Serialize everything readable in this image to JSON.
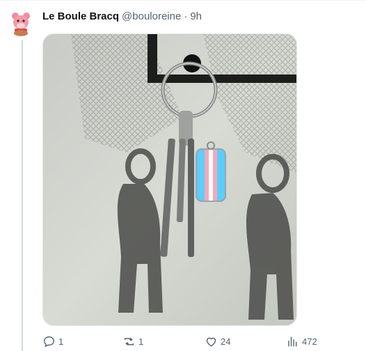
{
  "tweet": {
    "author": {
      "display_name": "Le Boule Bracq",
      "handle": "@bouloreine",
      "avatar_icon": "bear-avatar-icon"
    },
    "separator": "·",
    "timestamp": "9h",
    "media": {
      "kind": "photo",
      "flag_colors": [
        "#5bcefa",
        "#f5a9b8",
        "#ffffff",
        "#f5a9b8",
        "#5bcefa"
      ]
    },
    "actions": {
      "reply": {
        "icon": "reply-icon",
        "count": "1"
      },
      "retweet": {
        "icon": "retweet-icon",
        "count": "1"
      },
      "like": {
        "icon": "heart-icon",
        "count": "24"
      },
      "views": {
        "icon": "views-icon",
        "count": "472"
      }
    }
  }
}
